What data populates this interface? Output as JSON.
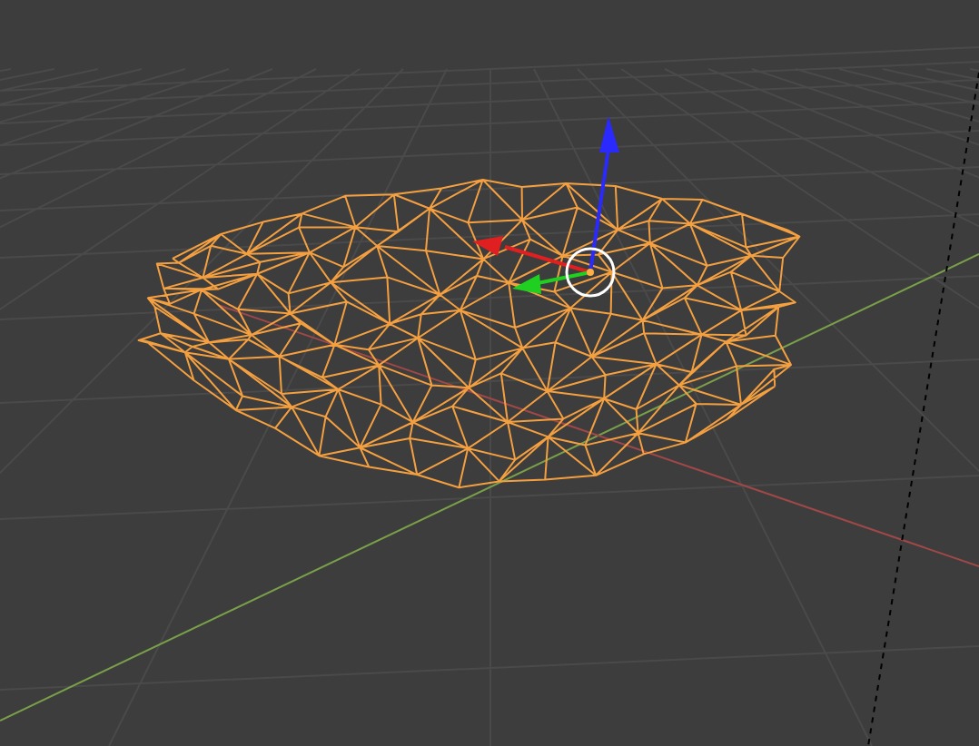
{
  "viewport": {
    "wireframe": true,
    "gizmo": true
  }
}
